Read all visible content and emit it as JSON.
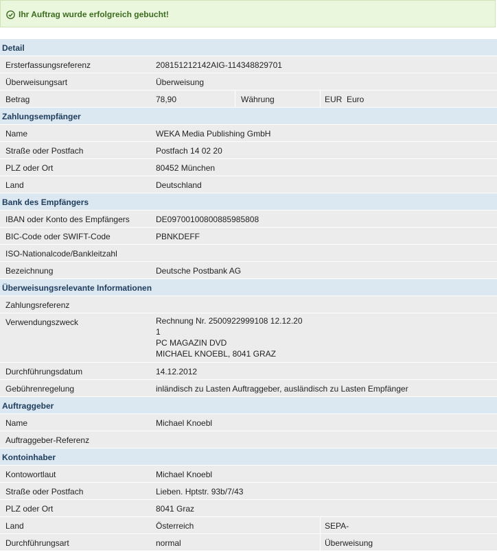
{
  "success": {
    "message": "Ihr Auftrag wurde erfolgreich gebucht!",
    "icon": "check-circle-icon",
    "color": "#3c6b1e"
  },
  "detail": {
    "title": "Detail",
    "erfassungsreferenz_label": "Ersterfassungsreferenz",
    "erfassungsreferenz_value": "208151212142AIG-114348829701",
    "art_label": "Überweisungsart",
    "art_value": "Überweisung",
    "betrag_label": "Betrag",
    "betrag_value": "78,90",
    "waehrung_label": "Währung",
    "waehrung_value": "EUR  Euro"
  },
  "empfaenger": {
    "title": "Zahlungsempfänger",
    "name_label": "Name",
    "name_value": "WEKA Media Publishing GmbH",
    "strasse_label": "Straße oder Postfach",
    "strasse_value": "Postfach 14 02 20",
    "plz_label": "PLZ oder Ort",
    "plz_value": "80452 München",
    "land_label": "Land",
    "land_value": "Deutschland"
  },
  "bank": {
    "title": "Bank des Empfängers",
    "iban_label": "IBAN oder Konto des Empfängers",
    "iban_value": "DE09700100800885985808",
    "bic_label": "BIC-Code oder SWIFT-Code",
    "bic_value": "PBNKDEFF",
    "iso_label": "ISO-Nationalcode/Bankleitzahl",
    "iso_value": "",
    "bez_label": "Bezeichnung",
    "bez_value": "Deutsche Postbank AG"
  },
  "info": {
    "title": "Überweisungsrelevante Informationen",
    "zref_label": "Zahlungsreferenz",
    "zref_value": "",
    "zweck_label": "Verwendungszweck",
    "zweck_lines": [
      "Rechnung Nr. 2500922999108 12.12.20",
      "1",
      "PC MAGAZIN DVD",
      "MICHAEL KNOEBL, 8041 GRAZ"
    ],
    "datum_label": "Durchführungsdatum",
    "datum_value": "14.12.2012",
    "gebuehr_label": "Gebührenregelung",
    "gebuehr_value": "inländisch zu Lasten Auftraggeber, ausländisch zu Lasten Empfänger"
  },
  "auftraggeber": {
    "title": "Auftraggeber",
    "name_label": "Name",
    "name_value": "Michael Knoebl",
    "ref_label": "Auftraggeber-Referenz",
    "ref_value": ""
  },
  "kontoinhaber": {
    "title": "Kontoinhaber",
    "wortlaut_label": "Kontowortlaut",
    "wortlaut_value": "Michael Knoebl",
    "strasse_label": "Straße oder Postfach",
    "strasse_value": "Lieben. Hptstr. 93b/7/43",
    "plz_label": "PLZ oder Ort",
    "plz_value": "8041 Graz",
    "land_label": "Land",
    "land_value": "Österreich",
    "land_extra": "SEPA-",
    "art_label": "Durchführungsart",
    "art_value": "normal",
    "art_extra": "Überweisung"
  }
}
